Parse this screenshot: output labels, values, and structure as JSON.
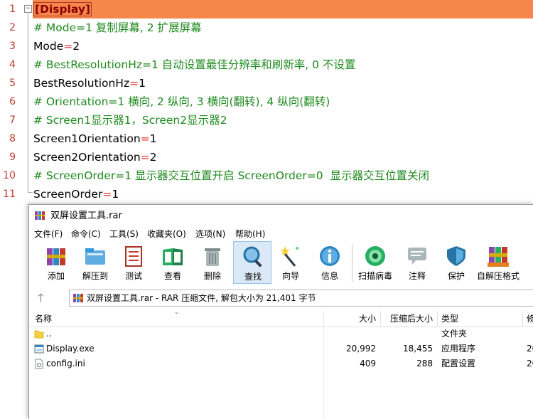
{
  "editor": {
    "lines": [
      {
        "num": "1",
        "segments": [
          {
            "text": "[Display]",
            "cls": "section-text"
          }
        ],
        "section": true
      },
      {
        "num": "2",
        "segments": [
          {
            "text": "# Mode=1 复制屏幕, 2 扩展屏幕",
            "cls": "comment"
          }
        ]
      },
      {
        "num": "3",
        "segments": [
          {
            "text": "Mode",
            "cls": ""
          },
          {
            "text": "=",
            "cls": "op"
          },
          {
            "text": "2",
            "cls": ""
          }
        ]
      },
      {
        "num": "4",
        "segments": [
          {
            "text": "# BestResolutionHz=1 自动设置最佳分辨率和刷新率, 0 不设置",
            "cls": "comment"
          }
        ]
      },
      {
        "num": "5",
        "segments": [
          {
            "text": "BestResolutionHz",
            "cls": ""
          },
          {
            "text": "=",
            "cls": "op"
          },
          {
            "text": "1",
            "cls": ""
          }
        ]
      },
      {
        "num": "6",
        "segments": [
          {
            "text": "# Orientation=1 横向, 2 纵向, 3 横向(翻转), 4 纵向(翻转)",
            "cls": "comment"
          }
        ]
      },
      {
        "num": "7",
        "segments": [
          {
            "text": "# Screen1显示器1，Screen2显示器2",
            "cls": "comment"
          }
        ]
      },
      {
        "num": "8",
        "segments": [
          {
            "text": "Screen1Orientation",
            "cls": ""
          },
          {
            "text": "=",
            "cls": "op"
          },
          {
            "text": "1",
            "cls": ""
          }
        ]
      },
      {
        "num": "9",
        "segments": [
          {
            "text": "Screen2Orientation",
            "cls": ""
          },
          {
            "text": "=",
            "cls": "op"
          },
          {
            "text": "2",
            "cls": ""
          }
        ]
      },
      {
        "num": "10",
        "segments": [
          {
            "text": "# ScreenOrder=1 显示器交互位置开启 ScreenOrder=0  显示器交互位置关闭",
            "cls": "comment"
          }
        ]
      },
      {
        "num": "11",
        "segments": [
          {
            "text": "ScreenOrder",
            "cls": ""
          },
          {
            "text": "=",
            "cls": "op"
          },
          {
            "text": "1",
            "cls": ""
          }
        ]
      }
    ]
  },
  "winrar": {
    "title": "双屏设置工具.rar",
    "menu": [
      "文件(F)",
      "命令(C)",
      "工具(S)",
      "收藏夹(O)",
      "选项(N)",
      "帮助(H)"
    ],
    "toolbar": [
      {
        "label": "添加",
        "icon": "add-archive-icon"
      },
      {
        "label": "解压到",
        "icon": "extract-to-icon"
      },
      {
        "label": "测试",
        "icon": "test-icon"
      },
      {
        "label": "查看",
        "icon": "view-icon"
      },
      {
        "label": "删除",
        "icon": "delete-icon"
      },
      {
        "label": "查找",
        "icon": "find-icon"
      },
      {
        "label": "向导",
        "icon": "wizard-icon"
      },
      {
        "label": "信息",
        "icon": "info-icon"
      },
      {
        "label": "扫描病毒",
        "icon": "virus-scan-icon"
      },
      {
        "label": "注释",
        "icon": "comment-icon"
      },
      {
        "label": "保护",
        "icon": "protect-icon"
      },
      {
        "label": "自解压格式",
        "icon": "sfx-icon"
      }
    ],
    "address": "双屏设置工具.rar - RAR 压缩文件, 解包大小为 21,401 字节",
    "columns": {
      "name": "名称",
      "size": "大小",
      "packed": "压缩后大小",
      "type": "类型",
      "modified": "修"
    },
    "files": [
      {
        "name": "..",
        "size": "",
        "packed": "",
        "type": "文件夹",
        "mod": "",
        "icon": "folder-icon"
      },
      {
        "name": "Display.exe",
        "size": "20,992",
        "packed": "18,455",
        "type": "应用程序",
        "mod": "20",
        "icon": "exe-file-icon"
      },
      {
        "name": "config.ini",
        "size": "409",
        "packed": "288",
        "type": "配置设置",
        "mod": "20",
        "icon": "ini-file-icon"
      }
    ]
  },
  "colors": {
    "section_bg": "#f5874a",
    "comment": "#1f8a1f",
    "operator": "#e53935",
    "line_number": "#c0392b"
  }
}
